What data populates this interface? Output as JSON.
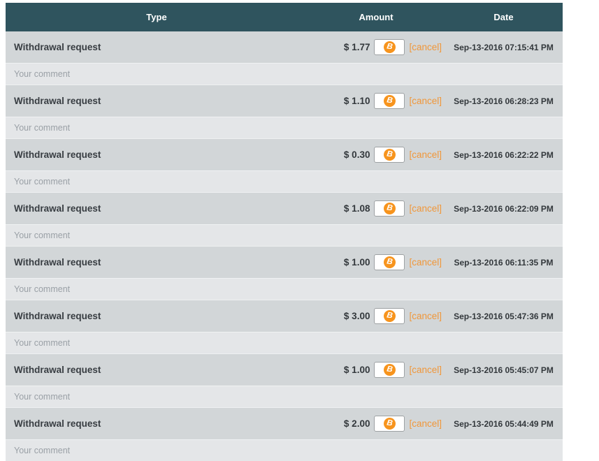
{
  "header": {
    "columns": [
      "Type",
      "Amount",
      "Date"
    ]
  },
  "icons": {
    "bitcoin_glyph": "B"
  },
  "colors": {
    "header_bg": "#2f545e",
    "row_bg": "#d2d6d8",
    "comment_row_bg": "#e4e6e8",
    "link_orange": "#f0973a",
    "bitcoin_orange": "#f7941d",
    "text_dark": "#33383c"
  },
  "rows": [
    {
      "type": "Withdrawal request",
      "amount": "$ 1.77",
      "cancel": "[cancel]",
      "date": "Sep-13-2016 07:15:41 PM",
      "comment": "Your comment"
    },
    {
      "type": "Withdrawal request",
      "amount": "$ 1.10",
      "cancel": "[cancel]",
      "date": "Sep-13-2016 06:28:23 PM",
      "comment": "Your comment"
    },
    {
      "type": "Withdrawal request",
      "amount": "$ 0.30",
      "cancel": "[cancel]",
      "date": "Sep-13-2016 06:22:22 PM",
      "comment": "Your comment"
    },
    {
      "type": "Withdrawal request",
      "amount": "$ 1.08",
      "cancel": "[cancel]",
      "date": "Sep-13-2016 06:22:09 PM",
      "comment": "Your comment"
    },
    {
      "type": "Withdrawal request",
      "amount": "$ 1.00",
      "cancel": "[cancel]",
      "date": "Sep-13-2016 06:11:35 PM",
      "comment": "Your comment"
    },
    {
      "type": "Withdrawal request",
      "amount": "$ 3.00",
      "cancel": "[cancel]",
      "date": "Sep-13-2016 05:47:36 PM",
      "comment": "Your comment"
    },
    {
      "type": "Withdrawal request",
      "amount": "$ 1.00",
      "cancel": "[cancel]",
      "date": "Sep-13-2016 05:45:07 PM",
      "comment": "Your comment"
    },
    {
      "type": "Withdrawal request",
      "amount": "$ 2.00",
      "cancel": "[cancel]",
      "date": "Sep-13-2016 05:44:49 PM",
      "comment": "Your comment"
    }
  ]
}
